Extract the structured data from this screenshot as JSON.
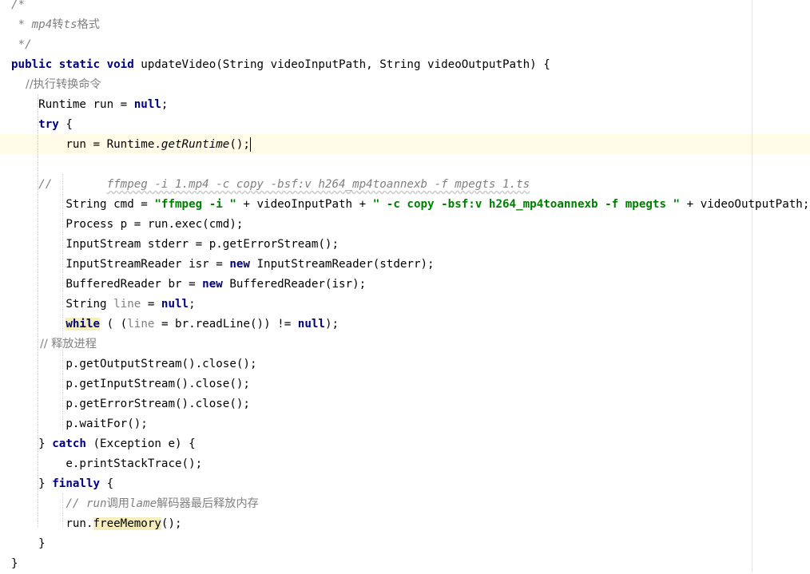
{
  "editor": {
    "l01": "/*",
    "l02a": " * ",
    "l02b": "mp4",
    "l02c": "转",
    "l02d": "ts",
    "l02e": "格式",
    "l03": " */",
    "l04": {
      "kw": "public static void",
      "rest": " updateVideo(String videoInputPath, String videoOutputPath) {"
    },
    "l05": "    //执行转换命令",
    "l06": {
      "a": "    Runtime run = ",
      "kw": "null",
      "b": ";"
    },
    "l07": {
      "indent": "    ",
      "kw": "try",
      "b": " {"
    },
    "l08": {
      "a": "        run = Runtime.",
      "m": "getRuntime",
      "b": "();"
    },
    "l09": {
      "a": "    //",
      "gap": "        ",
      "b": "ffmpeg -i 1.mp4 -c copy -bsf:v h264_mp4toannexb -f mpegts 1.ts"
    },
    "l10": {
      "a": "        String cmd = ",
      "s1": "\"ffmpeg -i \"",
      "b": " + videoInputPath + ",
      "s2": "\" -c copy -bsf:v h264_mp4toannexb -f mpegts \"",
      "c": " + videoOutputPath;"
    },
    "l11": "        Process p = run.exec(cmd);",
    "l12": "        InputStream stderr = p.getErrorStream();",
    "l13": {
      "a": "        InputStreamReader isr = ",
      "kw": "new",
      "b": " InputStreamReader(stderr);"
    },
    "l14": {
      "a": "        BufferedReader br = ",
      "kw": "new",
      "b": " BufferedReader(isr);"
    },
    "l15": {
      "a": "        String ",
      "u": "line",
      "b": " = ",
      "kw": "null",
      "c": ";"
    },
    "l16": {
      "indent": "        ",
      "kw": "while",
      "a": " ( (",
      "u": "line",
      "b": " = br.readLine()) != ",
      "kw2": "null",
      "c": ");"
    },
    "l17": "        // 释放进程",
    "l18": "        p.getOutputStream().close();",
    "l19": "        p.getInputStream().close();",
    "l20": "        p.getErrorStream().close();",
    "l21": "        p.waitFor();",
    "l22": {
      "a": "    } ",
      "kw": "catch",
      "b": " (Exception e) {"
    },
    "l23": "        e.printStackTrace();",
    "l24": {
      "a": "    } ",
      "kw": "finally",
      "b": " {"
    },
    "l25": {
      "a": "        // ",
      "b": "run",
      "c": "调用",
      "d": "lame",
      "e": "解码器最后释放内存"
    },
    "l26": {
      "a": "        run.",
      "m": "freeMemory",
      "b": "();"
    },
    "l27": "    }",
    "l28": "}"
  }
}
